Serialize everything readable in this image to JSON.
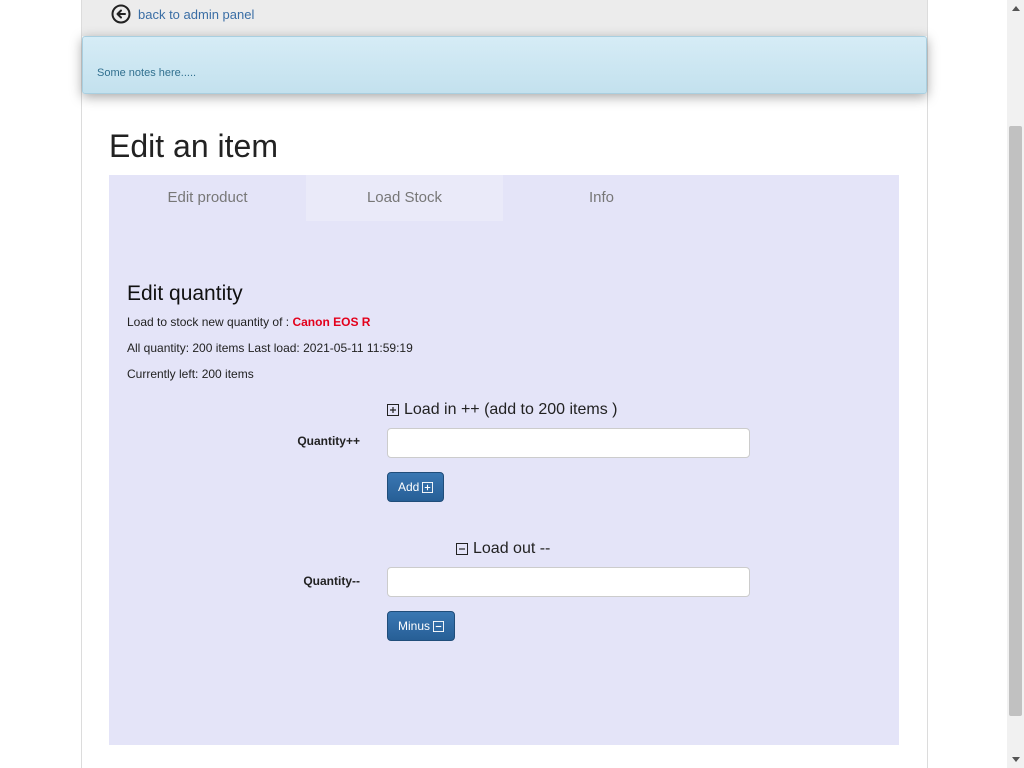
{
  "header": {
    "back_label": "back to admin panel"
  },
  "notes": {
    "text": "Some notes here....."
  },
  "page": {
    "title": "Edit an item"
  },
  "tabs": [
    {
      "label": "Edit product"
    },
    {
      "label": "Load Stock"
    },
    {
      "label": "Info"
    }
  ],
  "stock": {
    "section_title": "Edit quantity",
    "load_prefix": "Load to stock new quantity of : ",
    "product_name": "Canon EOS R",
    "all_quantity": "All quantity: 200 items Last load: 2021-05-11 11:59:19",
    "currently_left": "Currently left: 200 items"
  },
  "load_in": {
    "heading": "Load in ++ (add to 200 items )",
    "label": "Quantity++",
    "value": "",
    "button_label": "Add"
  },
  "load_out": {
    "heading": "Load out --",
    "label": "Quantity--",
    "value": "",
    "button_label": "Minus"
  },
  "colors": {
    "panel_bg": "#e4e4f8",
    "accent_button": "#2f6aa3",
    "product_highlight": "#e3001b",
    "notes_bg": "#c8e4f0"
  }
}
